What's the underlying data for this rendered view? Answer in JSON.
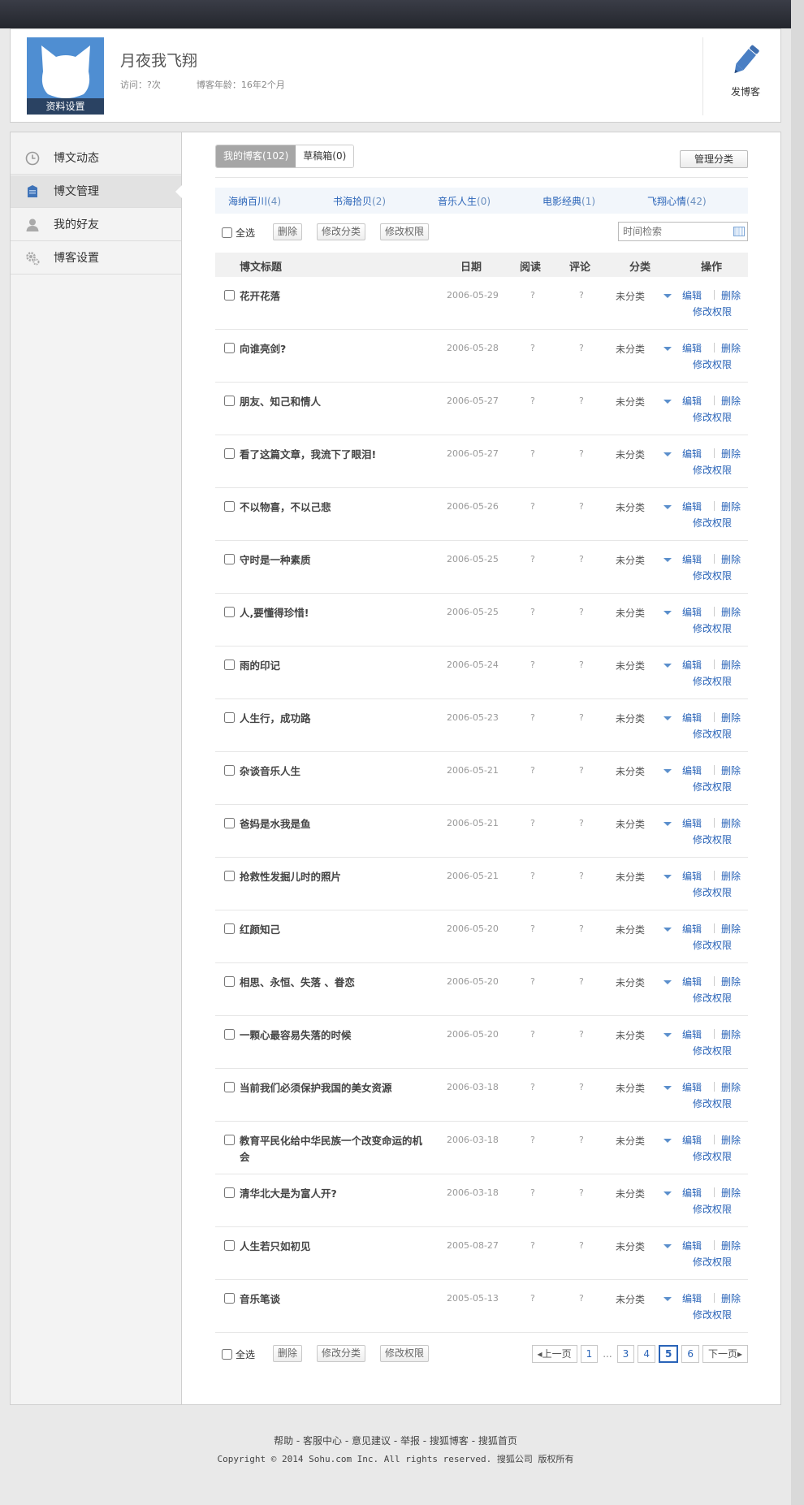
{
  "profile": {
    "name": "月夜我飞翔",
    "avatar_caption": "资料设置",
    "visits": "访问：?次",
    "age": "博客年龄：16年2个月",
    "post_button": "发博客"
  },
  "sidebar": {
    "items": [
      {
        "label": "博文动态",
        "icon": "clock-icon"
      },
      {
        "label": "博文管理",
        "icon": "document-icon"
      },
      {
        "label": "我的好友",
        "icon": "person-icon"
      },
      {
        "label": "博客设置",
        "icon": "gear-icon"
      }
    ],
    "active_index": 1
  },
  "tabs": {
    "my_blog": "我的博客(102)",
    "drafts": "草稿箱(0)",
    "manage_categories": "管理分类"
  },
  "categories": [
    {
      "name": "海纳百川",
      "count": "(4)"
    },
    {
      "name": "书海拾贝",
      "count": "(2)"
    },
    {
      "name": "音乐人生",
      "count": "(0)"
    },
    {
      "name": "电影经典",
      "count": "(1)"
    },
    {
      "name": "飞翔心情",
      "count": "(42)"
    }
  ],
  "toolbar": {
    "select_all": "全选",
    "delete": "删除",
    "change_category": "修改分类",
    "change_permission": "修改权限",
    "search_placeholder": "时间检索"
  },
  "table": {
    "headers": {
      "title": "博文标题",
      "date": "日期",
      "reads": "阅读",
      "comments": "评论",
      "category": "分类",
      "actions": "操作"
    },
    "rows": [
      {
        "title": "花开花落",
        "date": "2006-05-29",
        "reads": "?",
        "comments": "?",
        "category": "未分类"
      },
      {
        "title": "向谁亮剑?",
        "date": "2006-05-28",
        "reads": "?",
        "comments": "?",
        "category": "未分类"
      },
      {
        "title": "朋友、知己和情人",
        "date": "2006-05-27",
        "reads": "?",
        "comments": "?",
        "category": "未分类"
      },
      {
        "title": "看了这篇文章，我流下了眼泪!",
        "date": "2006-05-27",
        "reads": "?",
        "comments": "?",
        "category": "未分类"
      },
      {
        "title": "不以物喜，不以己悲",
        "date": "2006-05-26",
        "reads": "?",
        "comments": "?",
        "category": "未分类"
      },
      {
        "title": "守时是一种素质",
        "date": "2006-05-25",
        "reads": "?",
        "comments": "?",
        "category": "未分类"
      },
      {
        "title": "人,要懂得珍惜!",
        "date": "2006-05-25",
        "reads": "?",
        "comments": "?",
        "category": "未分类"
      },
      {
        "title": "雨的印记",
        "date": "2006-05-24",
        "reads": "?",
        "comments": "?",
        "category": "未分类"
      },
      {
        "title": "人生行，成功路",
        "date": "2006-05-23",
        "reads": "?",
        "comments": "?",
        "category": "未分类"
      },
      {
        "title": "杂谈音乐人生",
        "date": "2006-05-21",
        "reads": "?",
        "comments": "?",
        "category": "未分类"
      },
      {
        "title": "爸妈是水我是鱼",
        "date": "2006-05-21",
        "reads": "?",
        "comments": "?",
        "category": "未分类"
      },
      {
        "title": "抢救性发掘儿时的照片",
        "date": "2006-05-21",
        "reads": "?",
        "comments": "?",
        "category": "未分类"
      },
      {
        "title": "红颜知己",
        "date": "2006-05-20",
        "reads": "?",
        "comments": "?",
        "category": "未分类"
      },
      {
        "title": "相思、永恒、失落 、眷恋",
        "date": "2006-05-20",
        "reads": "?",
        "comments": "?",
        "category": "未分类"
      },
      {
        "title": "一颗心最容易失落的时候",
        "date": "2006-05-20",
        "reads": "?",
        "comments": "?",
        "category": "未分类"
      },
      {
        "title": "当前我们必须保护我国的美女资源",
        "date": "2006-03-18",
        "reads": "?",
        "comments": "?",
        "category": "未分类"
      },
      {
        "title": "教育平民化给中华民族一个改变命运的机会",
        "date": "2006-03-18",
        "reads": "?",
        "comments": "?",
        "category": "未分类"
      },
      {
        "title": "清华北大是为富人开?",
        "date": "2006-03-18",
        "reads": "?",
        "comments": "?",
        "category": "未分类"
      },
      {
        "title": "人生若只如初见",
        "date": "2005-08-27",
        "reads": "?",
        "comments": "?",
        "category": "未分类"
      },
      {
        "title": "音乐笔谈",
        "date": "2005-05-13",
        "reads": "?",
        "comments": "?",
        "category": "未分类"
      }
    ],
    "actions": {
      "edit": "编辑",
      "delete": "删除",
      "permission": "修改权限"
    }
  },
  "pager": {
    "prev": "上一页",
    "next": "下一页",
    "ellipsis": "...",
    "pages": [
      "1",
      "3",
      "4",
      "5",
      "6"
    ],
    "current": "5"
  },
  "footer": {
    "links": "帮助 - 客服中心 - 意见建议 - 举报 - 搜狐博客 - 搜狐首页",
    "copyright": "Copyright © 2014 Sohu.com Inc. All rights reserved. 搜狐公司 版权所有"
  },
  "colors": {
    "link": "#2a64b8",
    "avatar_bg": "#4f8ed2",
    "topbar": "#2b2d34"
  }
}
